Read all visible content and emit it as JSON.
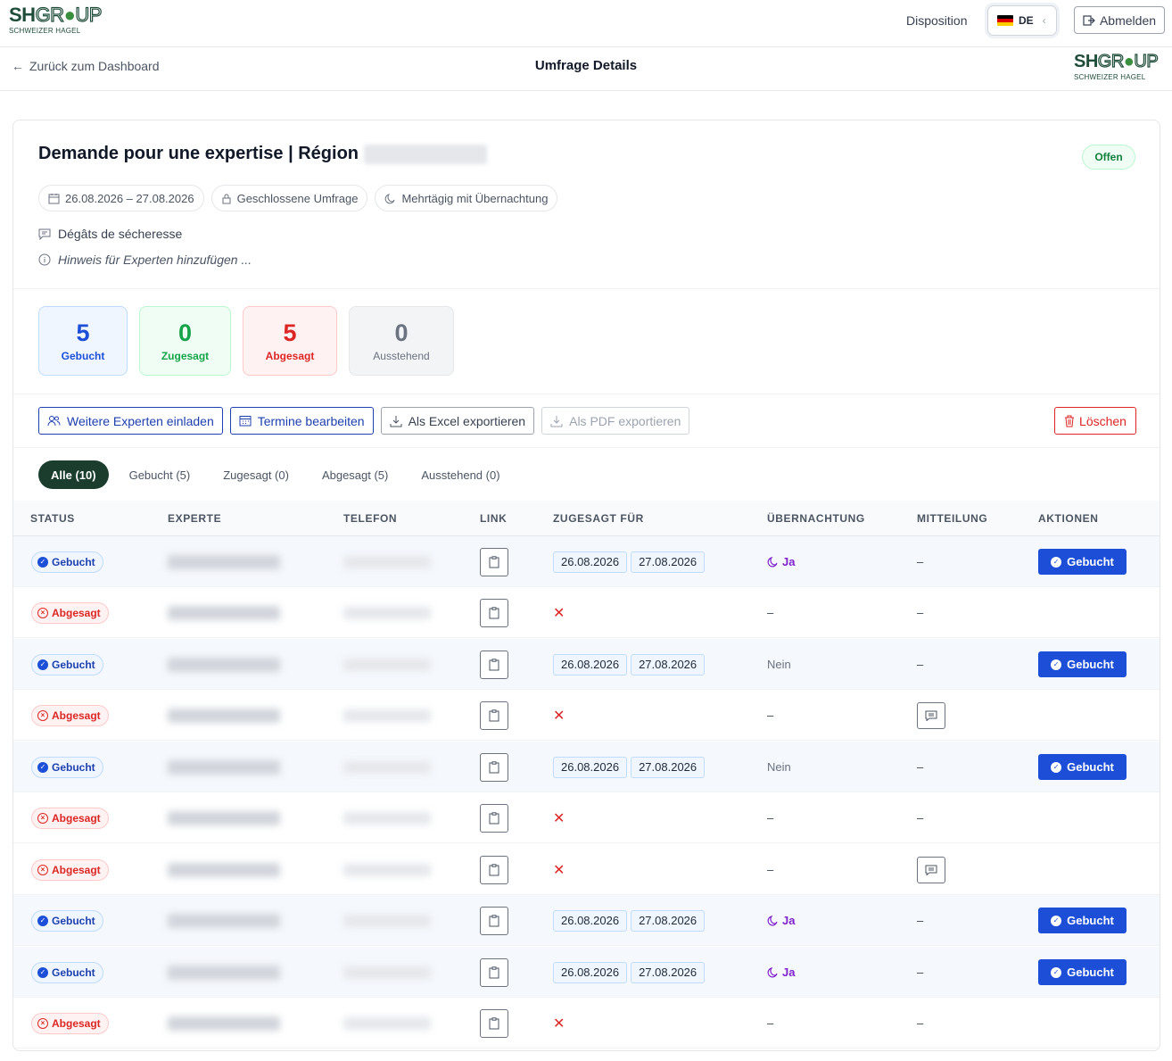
{
  "header": {
    "logo_main": "SHGR",
    "logo_o": "O",
    "logo_end": "UP",
    "logo_sub": "SCHWEIZER HAGEL",
    "disposition": "Disposition",
    "lang": "DE",
    "logout": "Abmelden"
  },
  "subheader": {
    "back": "Zurück zum Dashboard",
    "title": "Umfrage Details"
  },
  "survey": {
    "title": "Demande pour une expertise | Région",
    "status": "Offen",
    "date_range": "26.08.2026 – 27.08.2026",
    "type": "Geschlossene Umfrage",
    "duration": "Mehrtägig mit Übernachtung",
    "description": "Dégâts de sécheresse",
    "hint": "Hinweis für Experten hinzufügen ..."
  },
  "stats": [
    {
      "value": "5",
      "label": "Gebucht"
    },
    {
      "value": "0",
      "label": "Zugesagt"
    },
    {
      "value": "5",
      "label": "Abgesagt"
    },
    {
      "value": "0",
      "label": "Ausstehend"
    }
  ],
  "actions": {
    "invite": "Weitere Experten einladen",
    "edit_dates": "Termine bearbeiten",
    "export_excel": "Als Excel exportieren",
    "export_pdf": "Als PDF exportieren",
    "delete": "Löschen"
  },
  "tabs": [
    "Alle (10)",
    "Gebucht (5)",
    "Zugesagt (0)",
    "Abgesagt (5)",
    "Ausstehend (0)"
  ],
  "table": {
    "headers": [
      "STATUS",
      "EXPERTE",
      "TELEFON",
      "LINK",
      "ZUGESAGT FÜR",
      "ÜBERNACHTUNG",
      "MITTEILUNG",
      "AKTIONEN"
    ],
    "date1": "26.08.2026",
    "date2": "27.08.2026",
    "ja": "Ja",
    "nein": "Nein",
    "dash": "–",
    "action_label": "Gebucht",
    "status_gebucht": "Gebucht",
    "status_abgesagt": "Abgesagt"
  }
}
